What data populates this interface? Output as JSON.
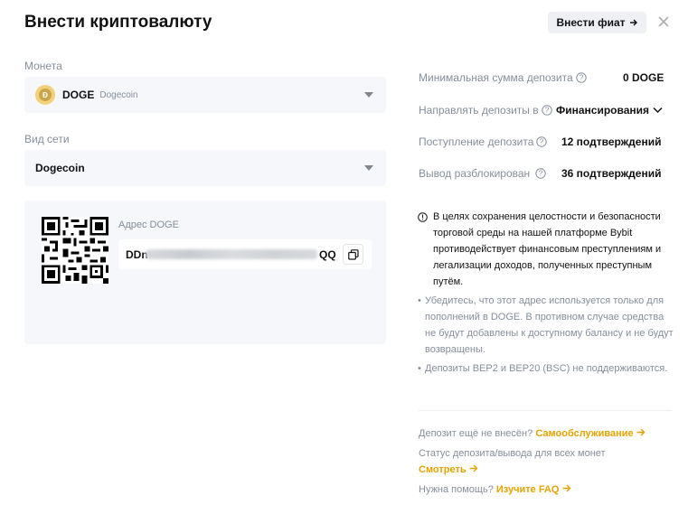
{
  "header": {
    "title": "Внести криптовалюту",
    "fiat_button": "Внести фиат"
  },
  "coin": {
    "label": "Монета",
    "symbol": "DOGE",
    "name": "Dogecoin"
  },
  "network": {
    "label": "Вид сети",
    "value": "Dogecoin"
  },
  "address": {
    "label": "Адрес DOGE",
    "prefix": "DDn",
    "suffix": "QQ"
  },
  "info": {
    "min_label": "Минимальная сумма депозита",
    "min_value": "0 DOGE",
    "direct_label": "Направлять депозиты в",
    "direct_value": "Финансирования",
    "arrival_label": "Поступление депозита",
    "arrival_value": "12 подтверждений",
    "unlock_label": "Вывод разблокирован",
    "unlock_value": "36 подтверждений"
  },
  "notes": {
    "main": "В целях сохранения целостности и безопасности торговой среды на нашей платформе Bybit противодействует финансовым преступлениям и легализации доходов, полученных преступным путём.",
    "bullet1": "Убедитесь, что этот адрес используется только для пополнений в DOGE. В противном случае средства не будут добавлены к доступному балансу и не будут возвращены.",
    "bullet2": "Депозиты BEP2 и BEP20 (BSC) не поддерживаются."
  },
  "help": {
    "not_arrived": "Депозит ещё не внесён?",
    "self_service": "Самообслуживание",
    "status_text": "Статус депозита/вывода для всех монет",
    "view": "Смотреть",
    "need_help": "Нужна помощь?",
    "faq": "Изучите FAQ"
  }
}
